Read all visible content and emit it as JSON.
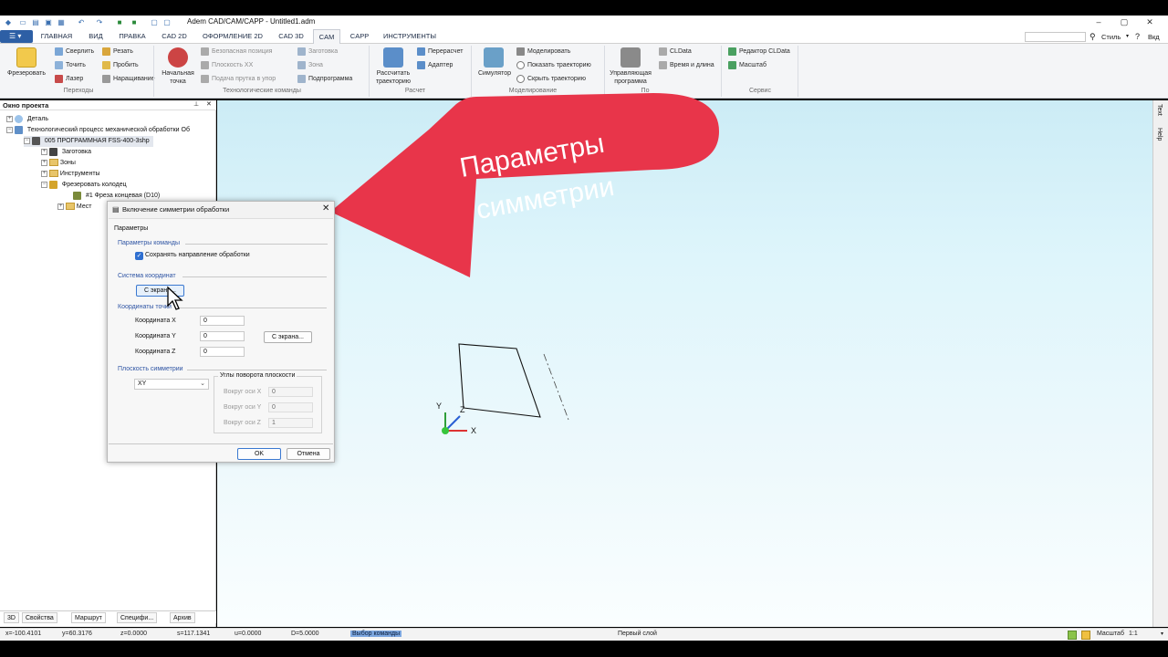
{
  "window": {
    "title": "Adem CAD/CAM/CAPP - Untitled1.adm"
  },
  "tabs": [
    {
      "label": "ГЛАВНАЯ"
    },
    {
      "label": "ВИД"
    },
    {
      "label": "ПРАВКА"
    },
    {
      "label": "CAD 2D"
    },
    {
      "label": "ОФОРМЛЕНИЕ 2D"
    },
    {
      "label": "CAD 3D"
    },
    {
      "label": "CAM"
    },
    {
      "label": "CAPP"
    },
    {
      "label": "ИНСТРУМЕНТЫ"
    }
  ],
  "header_right": {
    "style_label": "Стиль",
    "help_label": "Вкд"
  },
  "ribbon": {
    "mill_label": "Фрезеровать",
    "drill": "Сверлить",
    "cut": "Резать",
    "turn": "Точить",
    "punch": "Пробить",
    "laser": "Лазер",
    "build": "Наращивание",
    "group_transitions": "Переходы",
    "start_point": [
      "Начальная",
      "точка"
    ],
    "safe_pos": "Безопасная позиция",
    "plane_xx": "Плоскость XX",
    "feed_stop": "Подача прутка в упор",
    "blank": "Заготовка",
    "zone": "Зона",
    "subprog": "Подпрограмма",
    "group_tech": "Технологические команды",
    "calc_traj": [
      "Рассчитать",
      "траекторию"
    ],
    "recalc": "Перерасчет",
    "adapter": "Адаптер",
    "group_calc": "Расчет",
    "simulator": "Симулятор",
    "model": "Моделировать",
    "show_traj": "Показать траекторию",
    "hide_traj": "Скрыть траекторию",
    "group_model": "Моделирование",
    "control_prog": [
      "Управляющая",
      "программа"
    ],
    "cldata": "CLData",
    "time_len": "Время и длина",
    "group_post": "По",
    "cl_editor": "Редактор CLData",
    "scale": "Масштаб",
    "group_service": "Сервис"
  },
  "panel": {
    "title": "Окно проекта",
    "tree": [
      {
        "label": "Деталь"
      },
      {
        "label": "Технологический процесс механической обработки  Об"
      },
      {
        "label": "005  ПРОГРАММНАЯ FSS-400-3shp"
      },
      {
        "label": "Заготовка"
      },
      {
        "label": "Зоны"
      },
      {
        "label": "Инструменты"
      },
      {
        "label": "Фрезеровать колодец"
      },
      {
        "label": "#1 Фреза концевая (D10)"
      },
      {
        "label": "Мест"
      }
    ],
    "bottom_tabs": [
      "3D",
      "Свойства",
      "Маршрут",
      "Специфи...",
      "Архив"
    ]
  },
  "right_strip": [
    "Text",
    "Help"
  ],
  "dialog": {
    "title": "Включение симметрии обработки",
    "tab": "Параметры",
    "sec_command": "Параметры команды",
    "keep_direction": "Сохранять направление обработки",
    "keep_direction_checked": true,
    "sec_coord_system": "Система координат",
    "from_screen_1": "С экрана...",
    "sec_point": "Координаты точки",
    "coord_x_label": "Координата X",
    "coord_x": "0",
    "coord_y_label": "Координата Y",
    "coord_y": "0",
    "coord_z_label": "Координата Z",
    "coord_z": "0",
    "from_screen_2": "С экрана...",
    "sec_plane": "Плоскость симметрии",
    "plane_value": "XY",
    "angles_title": "Углы поворота плоскости",
    "around_x_label": "Вокруг оси X",
    "around_x": "0",
    "around_y_label": "Вокруг оси Y",
    "around_y": "0",
    "around_z_label": "Вокруг оси Z",
    "around_z": "1",
    "ok": "OK",
    "cancel": "Отмена"
  },
  "annotation": {
    "line1": "Параметры",
    "line2": "симметрии",
    "color": "#e8354a"
  },
  "axes": {
    "x": "X",
    "y": "Y",
    "z": "Z"
  },
  "status": {
    "x": "x=-100.4101",
    "y": "y=60.3176",
    "z": "z=0.0000",
    "s": "s=117.1341",
    "u": "u=0.0000",
    "d": "D=5.0000",
    "command": "Выбор команды",
    "layer": "Первый слой",
    "scale_label": "Масштаб",
    "scale_value": "1:1"
  }
}
